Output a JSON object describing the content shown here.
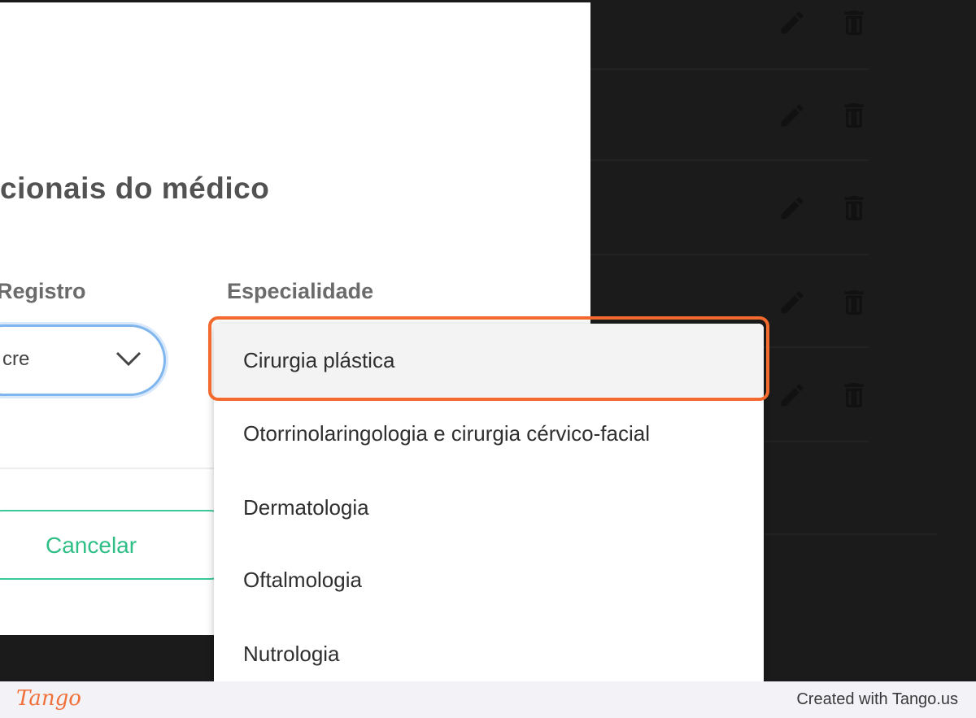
{
  "modal": {
    "title": "cionais do médico",
    "registro_label": "Registro",
    "registro_value": "cre",
    "especialidade_label": "Especialidade",
    "cancel_label": "Cancelar"
  },
  "dropdown": {
    "options": [
      {
        "label": "Cirurgia plástica",
        "selected": true
      },
      {
        "label": "Otorrinolaringologia e cirurgia cérvico-facial",
        "selected": false
      },
      {
        "label": "Dermatologia",
        "selected": false
      },
      {
        "label": "Oftalmologia",
        "selected": false
      },
      {
        "label": "Nutrologia",
        "selected": false
      }
    ]
  },
  "background_table": {
    "row_actions": [
      "edit-icon",
      "trash-icon"
    ],
    "row_count": 5
  },
  "footer": {
    "brand": "Tango",
    "created_text": "Created with Tango.us"
  },
  "colors": {
    "accent_green": "#2fbf86",
    "highlight_orange": "#f26a2e",
    "focus_blue": "#7fb6ee"
  }
}
